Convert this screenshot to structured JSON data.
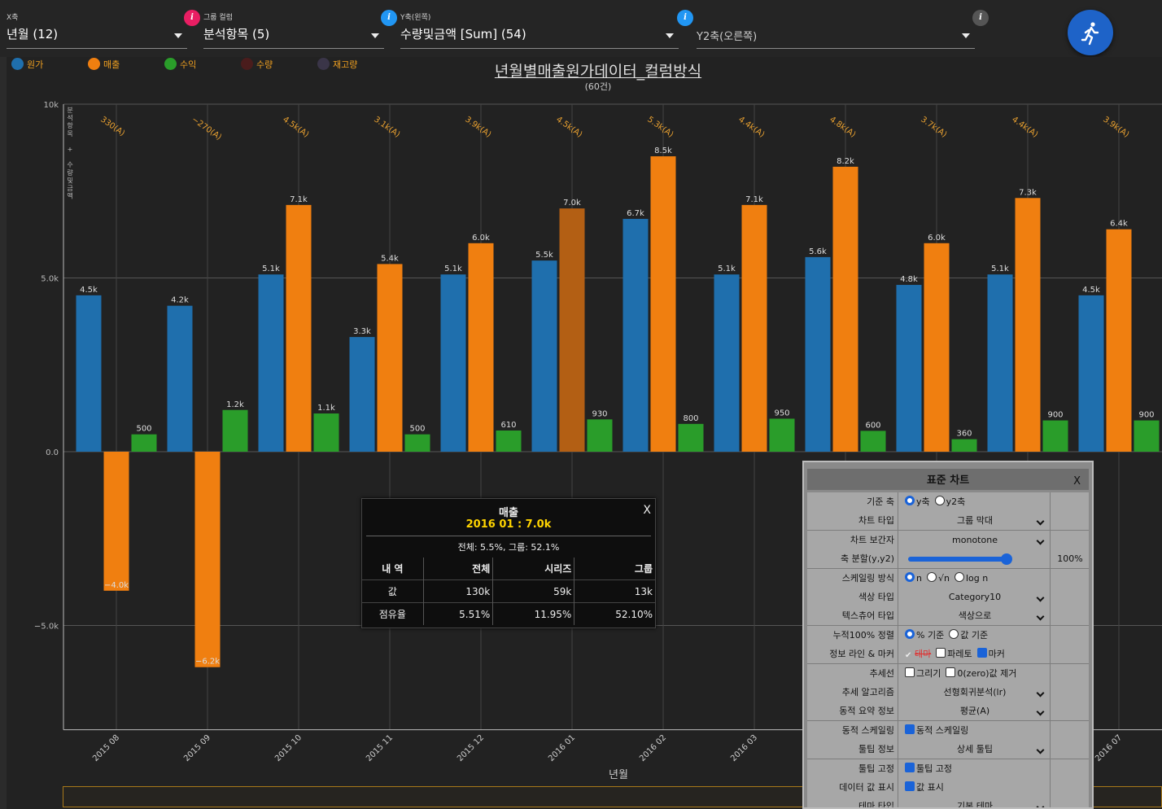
{
  "controls": {
    "x_axis": {
      "label": "X축",
      "value": "년월 (12)"
    },
    "group_column": {
      "label": "그룹 컬럼",
      "value": "분석항목 (5)"
    },
    "y_left": {
      "label": "Y축(왼쪽)",
      "value": "수량및금액 [Sum] (54)"
    },
    "y_right": {
      "label": "",
      "value": "Y2축(오른쪽)"
    },
    "info_glyph": "i",
    "info_colors": [
      "#e91e63",
      "#2196f3",
      "#2196f3",
      "#555555"
    ],
    "run_button_icon": "running-person-icon"
  },
  "chart_data": {
    "type": "bar",
    "title": "년월별매출원가데이터_컬럼방식",
    "subtitle": "(60건)",
    "xlabel": "년월",
    "ylabel": "분석항목 + 수량및금액",
    "ylim": [
      -8000,
      10000
    ],
    "yticks": [
      {
        "value": 10000,
        "label": "10k"
      },
      {
        "value": 5000,
        "label": "5.0k"
      },
      {
        "value": 0,
        "label": "0.0"
      },
      {
        "value": -5000,
        "label": "−5.0k"
      }
    ],
    "grid": true,
    "legend_position": "top-left",
    "categories": [
      "2015 08",
      "2015 09",
      "2015 10",
      "2015 11",
      "2015 12",
      "2016 01",
      "2016 02",
      "2016 03",
      "2016 04",
      "2016 05",
      "2016 06",
      "2016 07"
    ],
    "series": [
      {
        "name": "원가",
        "color": "#1f6fad",
        "values": [
          4500,
          4200,
          5100,
          3300,
          5100,
          5500,
          6700,
          5100,
          5600,
          4800,
          5100,
          4500
        ],
        "labels": [
          "4.5k",
          "4.2k",
          "5.1k",
          "3.3k",
          "5.1k",
          "5.5k",
          "6.7k",
          "5.1k",
          "5.6k",
          "4.8k",
          "5.1k",
          "4.5k"
        ]
      },
      {
        "name": "매출",
        "color": "#f07f10",
        "values": [
          -4000,
          -6200,
          7100,
          5400,
          6000,
          7000,
          8500,
          7100,
          8200,
          6000,
          7300,
          6400
        ],
        "labels": [
          "−4.0k",
          "−6.2k",
          "7.1k",
          "5.4k",
          "6.0k",
          "7.0k",
          "8.5k",
          "7.1k",
          "8.2k",
          "6.0k",
          "7.3k",
          "6.4k"
        ]
      },
      {
        "name": "수익",
        "color": "#2a9d2a",
        "values": [
          500,
          1200,
          1100,
          500,
          610,
          930,
          800,
          950,
          600,
          360,
          900,
          900
        ],
        "labels": [
          "500",
          "1.2k",
          "1.1k",
          "500",
          "610",
          "930",
          "800",
          "950",
          "600",
          "360",
          "900",
          "900"
        ]
      },
      {
        "name": "수량",
        "color": "#4a1c1c",
        "values": []
      },
      {
        "name": "재고량",
        "color": "#3a3548",
        "values": []
      }
    ],
    "annotations": [
      "330(A)",
      "−270(A)",
      "4.5k(A)",
      "3.1k(A)",
      "3.9k(A)",
      "4.5k(A)",
      "5.3k(A)",
      "4.4k(A)",
      "4.8k(A)",
      "3.7k(A)",
      "4.4k(A)",
      "3.9k(A)"
    ],
    "highlight": {
      "series": "매출",
      "category": "2016 01"
    }
  },
  "tooltip": {
    "header": "매출",
    "subheader": "2016 01 : 7.0k",
    "close": "X",
    "summary": "전체: 5.5%, 그룹: 52.1%",
    "columns": [
      "내 역",
      "전체",
      "시리즈",
      "그룹"
    ],
    "rows": [
      [
        "값",
        "130k",
        "59k",
        "13k"
      ],
      [
        "점유율",
        "5.51%",
        "11.95%",
        "52.10%"
      ]
    ]
  },
  "panel": {
    "title": "표준 차트",
    "close": "X",
    "rows": [
      {
        "key": "기준 축",
        "options": [
          {
            "label": "y축",
            "on": true
          },
          {
            "label": "y2축",
            "on": false
          }
        ]
      },
      {
        "key": "차트 타입",
        "select": "그룹 막대"
      },
      {
        "key": "차트 보간자",
        "select": "monotone"
      },
      {
        "key": "축 분할(y,y2)",
        "slider": 100,
        "extra": "100%"
      },
      {
        "key": "스케일링 방식",
        "options": [
          {
            "label": "n",
            "on": true
          },
          {
            "label": "√n",
            "on": false
          },
          {
            "label": "log n",
            "on": false
          }
        ]
      },
      {
        "key": "색상 타입",
        "select": "Category10"
      },
      {
        "key": "텍스츄어 타입",
        "select": "색상으로"
      },
      {
        "key": "누적100% 정렬",
        "options": [
          {
            "label": "% 기준",
            "on": true
          },
          {
            "label": "값 기준",
            "on": false
          }
        ]
      },
      {
        "key": "정보 라인 & 마커",
        "checks": [
          {
            "label": "테마",
            "on": true,
            "red": true
          },
          {
            "label": "파레토",
            "on": false
          },
          {
            "label": "마커",
            "on": true
          }
        ]
      },
      {
        "key": "추세선",
        "checks": [
          {
            "label": "그리기",
            "on": false
          },
          {
            "label": "0(zero)값 제거",
            "on": false
          }
        ]
      },
      {
        "key": "추세 알고리즘",
        "select": "선형회귀분석(lr)"
      },
      {
        "key": "동적 요약 정보",
        "select": "평균(A)"
      },
      {
        "key": "동적 스케일링",
        "checks": [
          {
            "label": "동적 스케일링",
            "on": true
          }
        ]
      },
      {
        "key": "툴팁 정보",
        "select": "상세 툴팁"
      },
      {
        "key": "툴팁 고정",
        "checks": [
          {
            "label": "툴팁 고정",
            "on": true
          }
        ]
      },
      {
        "key": "데이터 값 표시",
        "checks": [
          {
            "label": "값 표시",
            "on": true
          }
        ]
      },
      {
        "key": "테마 타입",
        "select": "기본 테마"
      }
    ]
  }
}
